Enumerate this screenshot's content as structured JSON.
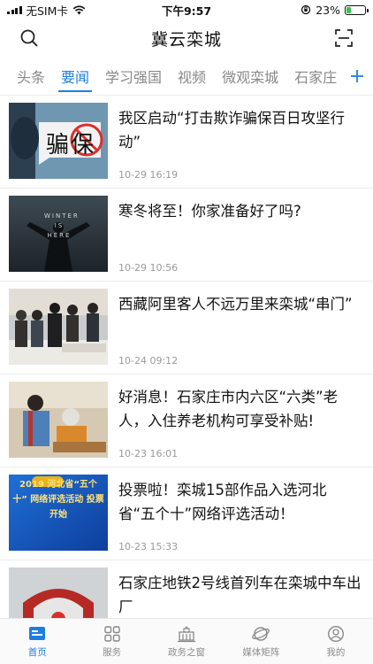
{
  "status_bar": {
    "carrier": "无SIM卡",
    "time": "下午9:57",
    "battery": "23%",
    "battery_level": 0.23
  },
  "header": {
    "title": "冀云栾城",
    "search_icon": "search-icon",
    "scan_icon": "scan-icon"
  },
  "tabs": [
    {
      "label": "头条",
      "active": false
    },
    {
      "label": "要闻",
      "active": true
    },
    {
      "label": "学习强国",
      "active": false
    },
    {
      "label": "视频",
      "active": false
    },
    {
      "label": "微观栾城",
      "active": false
    },
    {
      "label": "石家庄",
      "active": false
    }
  ],
  "news": [
    {
      "title": "我区启动“打击欺诈骗保百日攻坚行动”",
      "time": "10-29 16:19",
      "thumb_text": "骗保"
    },
    {
      "title": "寒冬将至！你家准备好了吗?",
      "time": "10-29 10:56",
      "thumb_text": "WINTER IS HERE"
    },
    {
      "title": "西藏阿里客人不远万里来栾城“串门”",
      "time": "10-24 09:12"
    },
    {
      "title": "好消息！石家庄市内六区“六类”老人，入住养老机构可享受补贴!",
      "time": "10-23 16:01"
    },
    {
      "title": "投票啦！栾城15部作品入选河北省“五个十”网络评选活动！",
      "time": "10-23 15:33",
      "thumb_text": "2019 河北省“五个十” 网络评选活动 投票开始"
    },
    {
      "title": "石家庄地铁2号线首列车在栾城中车出厂",
      "time": ""
    }
  ],
  "bottom_nav": [
    {
      "label": "首页",
      "icon": "home-icon",
      "active": true
    },
    {
      "label": "服务",
      "icon": "grid-icon",
      "active": false
    },
    {
      "label": "政务之窗",
      "icon": "government-icon",
      "active": false
    },
    {
      "label": "媒体矩阵",
      "icon": "planet-icon",
      "active": false
    },
    {
      "label": "我的",
      "icon": "user-icon",
      "active": false
    }
  ],
  "colors": {
    "accent": "#1e7ee0",
    "battery_fill": "#3cc14b",
    "muted_text": "#888888"
  }
}
